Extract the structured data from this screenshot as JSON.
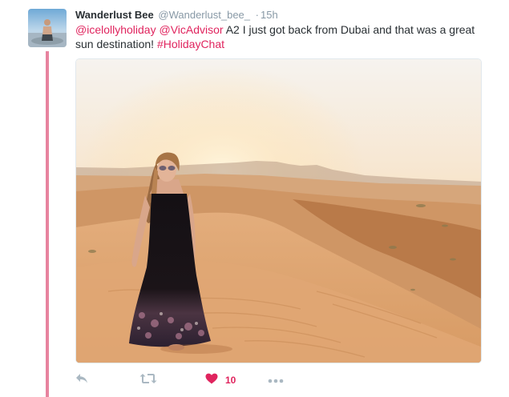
{
  "tweet": {
    "author_name": "Wanderlust Bee",
    "author_handle": "@Wanderlust_bee_",
    "separator": "·",
    "time": "15h",
    "text": {
      "mention1": "@icelollyholiday",
      "mention2": "@VicAdvisor",
      "body": " A2 I just got back from Dubai and that was a great sun destination! ",
      "hashtag": "#HolidayChat"
    },
    "like_count": "10"
  },
  "icons": {
    "reply": "reply-icon",
    "retweet": "retweet-icon",
    "like": "heart-icon",
    "more": "more-icon"
  },
  "colors": {
    "accent": "#e0245e",
    "thread_line": "#e7839f",
    "muted_icon": "#aab8c2",
    "text": "#292f33",
    "meta": "#8899a6"
  }
}
